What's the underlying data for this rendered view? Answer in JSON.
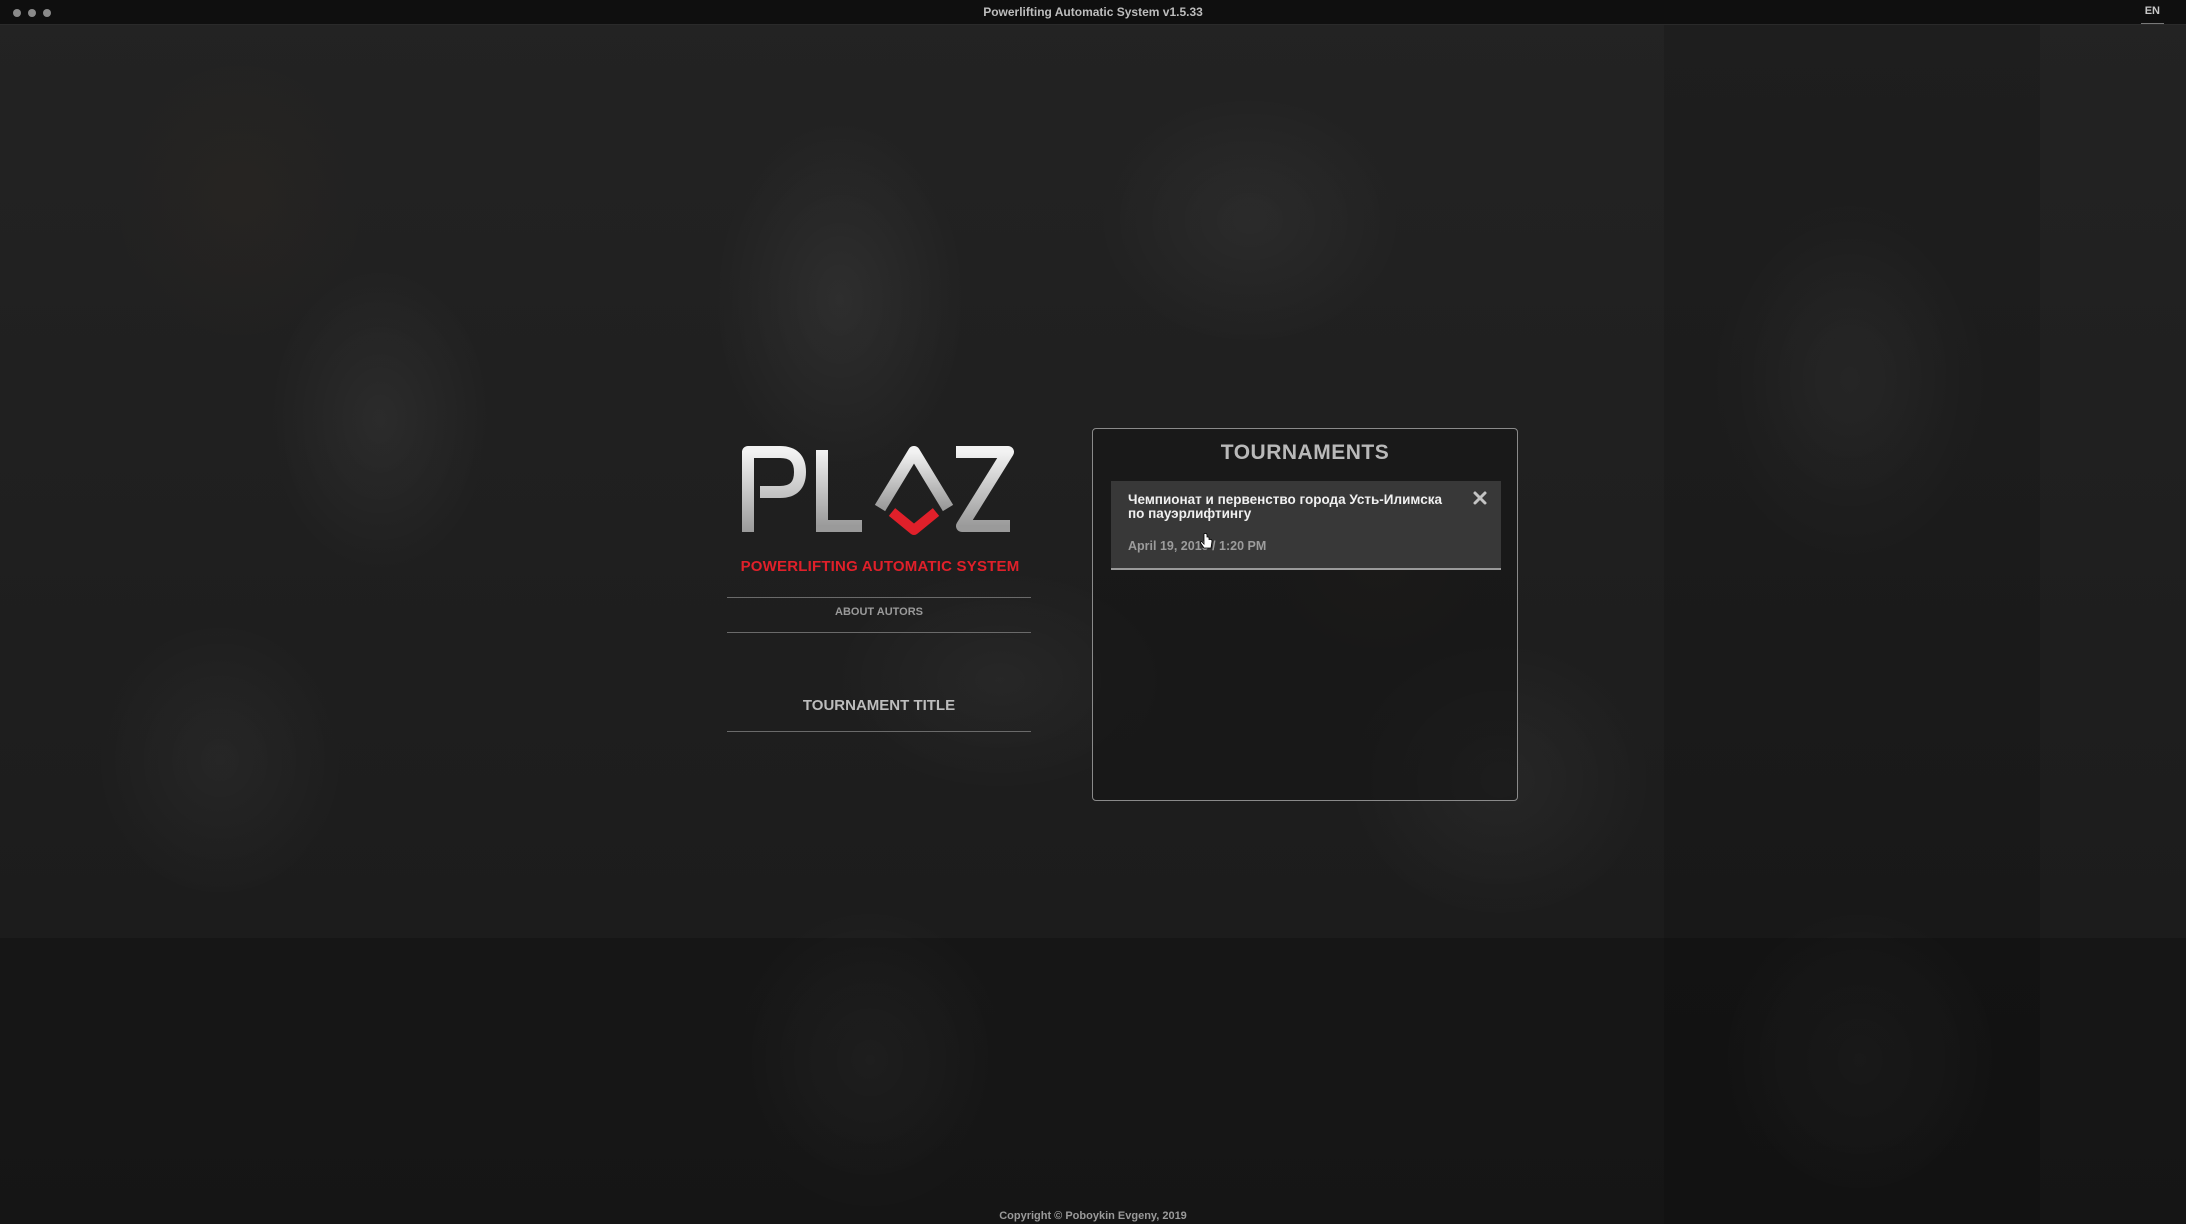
{
  "window": {
    "title": "Powerlifting Automatic System v1.5.33",
    "language": "EN"
  },
  "logo": {
    "text": "PLAS",
    "subtitle": "POWERLIFTING AUTOMATIC SYSTEM",
    "accent_color": "#e0202a"
  },
  "nav": {
    "about_label": "ABOUT AUTORS",
    "tournament_title_placeholder": "TOURNAMENT TITLE"
  },
  "tournaments": {
    "heading": "TOURNAMENTS",
    "items": [
      {
        "name": "Чемпионат и первенство города Усть-Илимска по пауэрлифтингу",
        "date": "April 19, 2019 / 1:20 PM"
      }
    ]
  },
  "footer": {
    "copyright": "Copyright © Poboykin Evgeny, 2019"
  }
}
